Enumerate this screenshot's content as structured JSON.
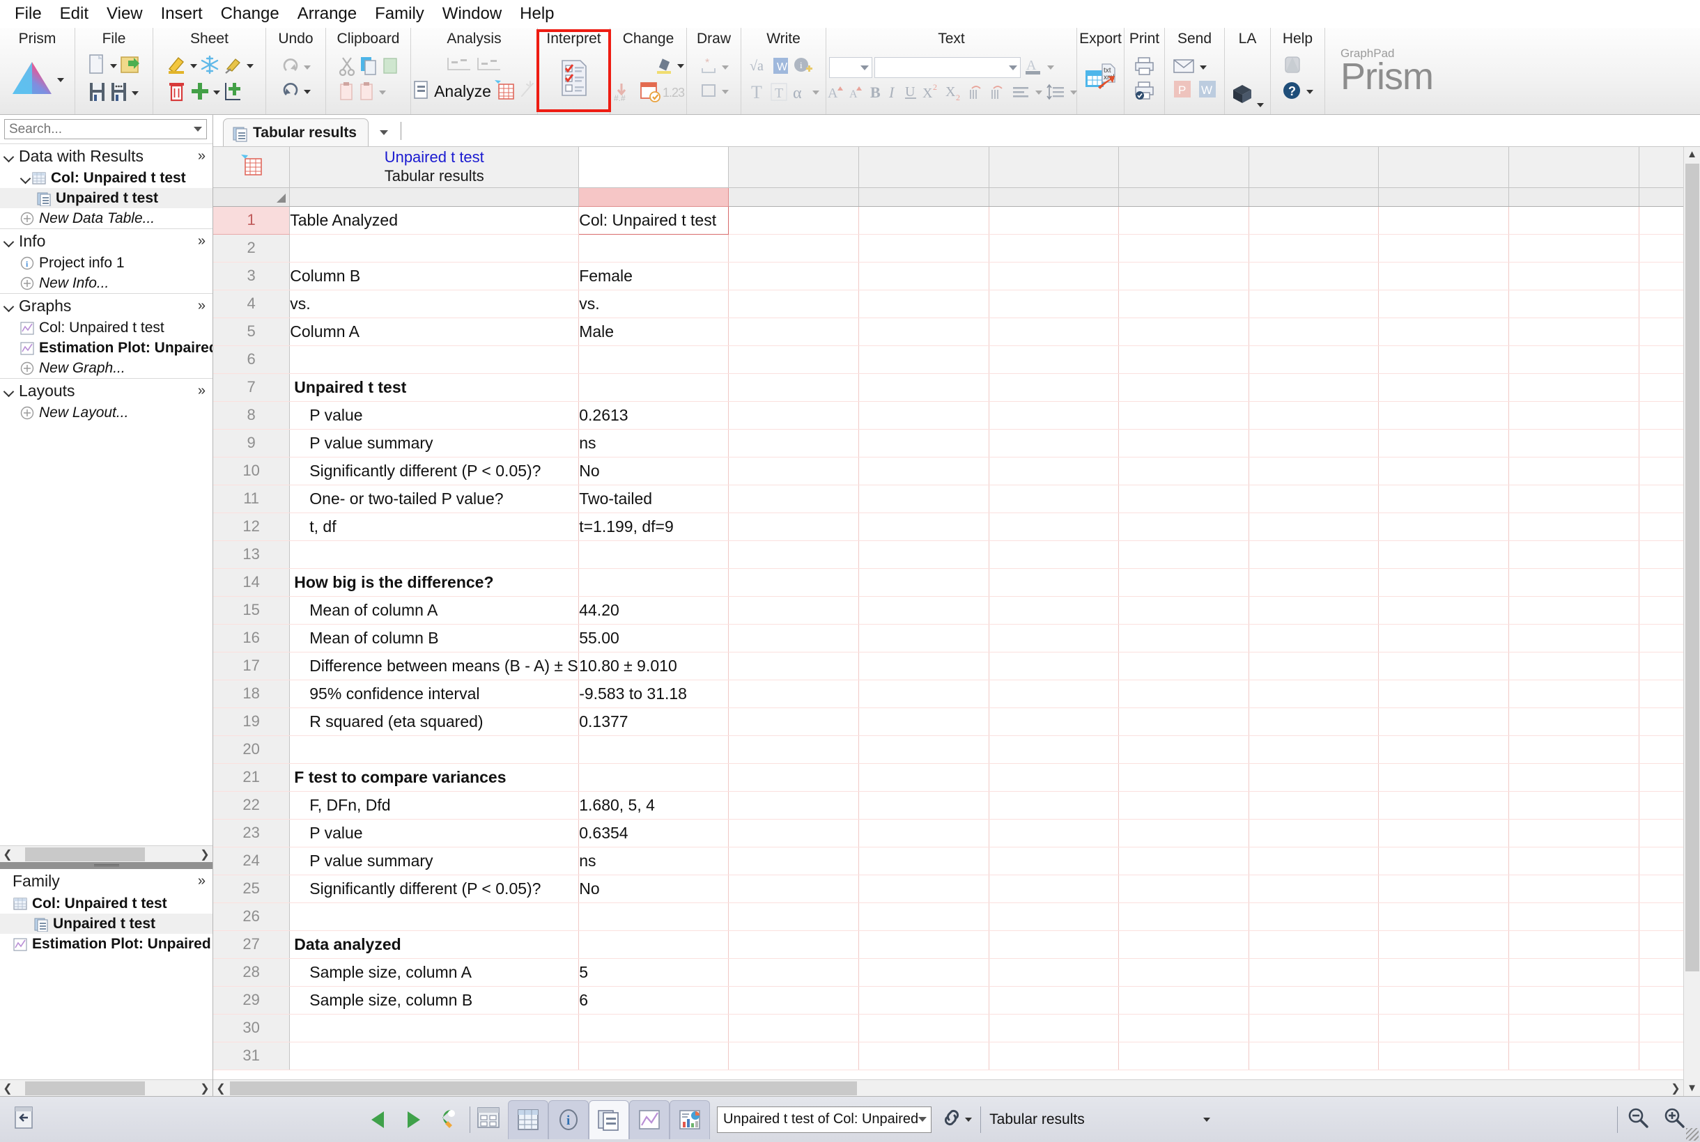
{
  "menubar": {
    "items": [
      "File",
      "Edit",
      "View",
      "Insert",
      "Change",
      "Arrange",
      "Family",
      "Window",
      "Help"
    ]
  },
  "ribbon": {
    "groups": [
      {
        "label": "Prism"
      },
      {
        "label": "File"
      },
      {
        "label": "Sheet"
      },
      {
        "label": "Undo"
      },
      {
        "label": "Clipboard"
      },
      {
        "label": "Analysis",
        "analyze_label": "Analyze"
      },
      {
        "label": "Interpret",
        "highlighted": true
      },
      {
        "label": "Change"
      },
      {
        "label": "Draw"
      },
      {
        "label": "Write"
      },
      {
        "label": "Text"
      },
      {
        "label": "Export"
      },
      {
        "label": "Print"
      },
      {
        "label": "Send"
      },
      {
        "label": "LA"
      },
      {
        "label": "Help"
      }
    ],
    "wordmark": {
      "brand": "GraphPad",
      "product": "Prism"
    },
    "highlight_color": "#ee1c12"
  },
  "navigator": {
    "search": {
      "placeholder": "Search...",
      "value": ""
    },
    "sections": [
      {
        "title": "Data with Results",
        "more": "»",
        "items": [
          {
            "label": "Col: Unpaired t test",
            "icon": "table-icon",
            "indent": 1,
            "bold": true,
            "selected": false,
            "italic": false,
            "twisty": true
          },
          {
            "label": "Unpaired t test",
            "icon": "results-sheet-icon",
            "indent": 2,
            "bold": true,
            "selected": true,
            "italic": false,
            "twisty": false
          },
          {
            "label": "New Data Table...",
            "icon": "plus-circle-icon",
            "indent": 3,
            "bold": false,
            "selected": false,
            "italic": true,
            "twisty": false
          }
        ]
      },
      {
        "title": "Info",
        "more": "»",
        "items": [
          {
            "label": "Project info 1",
            "icon": "info-circle-icon",
            "indent": 3,
            "bold": false,
            "selected": false,
            "italic": false,
            "twisty": false
          },
          {
            "label": "New Info...",
            "icon": "plus-circle-icon",
            "indent": 3,
            "bold": false,
            "selected": false,
            "italic": true,
            "twisty": false
          }
        ]
      },
      {
        "title": "Graphs",
        "more": "»",
        "items": [
          {
            "label": "Col: Unpaired t test",
            "icon": "graph-icon",
            "indent": 3,
            "bold": false,
            "selected": false,
            "italic": false,
            "twisty": false
          },
          {
            "label": "Estimation Plot: Unpaired t test of",
            "icon": "graph-icon",
            "indent": 3,
            "bold": true,
            "selected": false,
            "italic": false,
            "twisty": false
          },
          {
            "label": "New Graph...",
            "icon": "plus-circle-icon",
            "indent": 3,
            "bold": false,
            "selected": false,
            "italic": true,
            "twisty": false
          }
        ]
      },
      {
        "title": "Layouts",
        "more": "»",
        "items": [
          {
            "label": "New Layout...",
            "icon": "plus-circle-icon",
            "indent": 3,
            "bold": false,
            "selected": false,
            "italic": true,
            "twisty": false
          }
        ]
      }
    ],
    "family": {
      "title": "Family",
      "more": "»",
      "items": [
        {
          "label": "Col: Unpaired t test",
          "icon": "table-icon",
          "indent": 0,
          "bold": true,
          "selected": false
        },
        {
          "label": "Unpaired t test",
          "icon": "results-sheet-icon",
          "indent": 1,
          "bold": true,
          "selected": true
        },
        {
          "label": "Estimation Plot: Unpaired t test of",
          "icon": "graph-icon",
          "indent": 0,
          "bold": true,
          "selected": false
        }
      ]
    }
  },
  "sheet": {
    "tab": {
      "label": "Tabular results",
      "icon": "results-sheet-icon"
    },
    "title": {
      "main": "Unpaired t test",
      "sub": "Tabular results"
    },
    "selected_cell": "row1-colB"
  },
  "table": {
    "rows": [
      {
        "n": "1",
        "label": "Table Analyzed",
        "indent": 0,
        "bold": false,
        "value": "Col: Unpaired t test",
        "selected": true
      },
      {
        "n": "2",
        "label": "",
        "indent": 0,
        "bold": false,
        "value": "",
        "selected": false
      },
      {
        "n": "3",
        "label": "Column B",
        "indent": 0,
        "bold": false,
        "value": "Female",
        "selected": false
      },
      {
        "n": "4",
        "label": "vs.",
        "indent": 0,
        "bold": false,
        "value": "vs.",
        "selected": false
      },
      {
        "n": "5",
        "label": "Column A",
        "indent": 0,
        "bold": false,
        "value": "Male",
        "selected": false
      },
      {
        "n": "6",
        "label": "",
        "indent": 0,
        "bold": false,
        "value": "",
        "selected": false
      },
      {
        "n": "7",
        "label": "Unpaired t test",
        "indent": 0,
        "bold": true,
        "value": "",
        "selected": false
      },
      {
        "n": "8",
        "label": "P value",
        "indent": 1,
        "bold": false,
        "value": "0.2613",
        "selected": false
      },
      {
        "n": "9",
        "label": "P value summary",
        "indent": 1,
        "bold": false,
        "value": "ns",
        "selected": false
      },
      {
        "n": "10",
        "label": "Significantly different (P < 0.05)?",
        "indent": 1,
        "bold": false,
        "value": "No",
        "selected": false
      },
      {
        "n": "11",
        "label": "One- or two-tailed P value?",
        "indent": 1,
        "bold": false,
        "value": "Two-tailed",
        "selected": false
      },
      {
        "n": "12",
        "label": "t, df",
        "indent": 1,
        "bold": false,
        "value": "t=1.199, df=9",
        "selected": false
      },
      {
        "n": "13",
        "label": "",
        "indent": 0,
        "bold": false,
        "value": "",
        "selected": false
      },
      {
        "n": "14",
        "label": "How big is the difference?",
        "indent": 0,
        "bold": true,
        "value": "",
        "selected": false
      },
      {
        "n": "15",
        "label": "Mean of column A",
        "indent": 1,
        "bold": false,
        "value": "44.20",
        "selected": false
      },
      {
        "n": "16",
        "label": "Mean of column B",
        "indent": 1,
        "bold": false,
        "value": "55.00",
        "selected": false
      },
      {
        "n": "17",
        "label": "Difference between means (B - A) ± SEM",
        "indent": 1,
        "bold": false,
        "value": "10.80 ± 9.010",
        "selected": false
      },
      {
        "n": "18",
        "label": "95% confidence interval",
        "indent": 1,
        "bold": false,
        "value": "-9.583 to 31.18",
        "selected": false
      },
      {
        "n": "19",
        "label": "R squared (eta squared)",
        "indent": 1,
        "bold": false,
        "value": "0.1377",
        "selected": false
      },
      {
        "n": "20",
        "label": "",
        "indent": 0,
        "bold": false,
        "value": "",
        "selected": false
      },
      {
        "n": "21",
        "label": "F test to compare variances",
        "indent": 0,
        "bold": true,
        "value": "",
        "selected": false
      },
      {
        "n": "22",
        "label": "F, DFn, Dfd",
        "indent": 1,
        "bold": false,
        "value": "1.680, 5, 4",
        "selected": false
      },
      {
        "n": "23",
        "label": "P value",
        "indent": 1,
        "bold": false,
        "value": "0.6354",
        "selected": false
      },
      {
        "n": "24",
        "label": "P value summary",
        "indent": 1,
        "bold": false,
        "value": "ns",
        "selected": false
      },
      {
        "n": "25",
        "label": "Significantly different (P < 0.05)?",
        "indent": 1,
        "bold": false,
        "value": "No",
        "selected": false
      },
      {
        "n": "26",
        "label": "",
        "indent": 0,
        "bold": false,
        "value": "",
        "selected": false
      },
      {
        "n": "27",
        "label": "Data analyzed",
        "indent": 0,
        "bold": true,
        "value": "",
        "selected": false
      },
      {
        "n": "28",
        "label": "Sample size, column A",
        "indent": 1,
        "bold": false,
        "value": "5",
        "selected": false
      },
      {
        "n": "29",
        "label": "Sample size, column B",
        "indent": 1,
        "bold": false,
        "value": "6",
        "selected": false
      },
      {
        "n": "30",
        "label": "",
        "indent": 0,
        "bold": false,
        "value": "",
        "selected": false
      },
      {
        "n": "31",
        "label": "",
        "indent": 0,
        "bold": false,
        "value": "",
        "selected": false
      }
    ]
  },
  "statusbar": {
    "sheet_select": {
      "value": "Unpaired t test of Col: Unpaired"
    },
    "current_view": "Tabular results",
    "zoom_out": "zoom-out-icon",
    "zoom_in": "zoom-in-icon"
  }
}
